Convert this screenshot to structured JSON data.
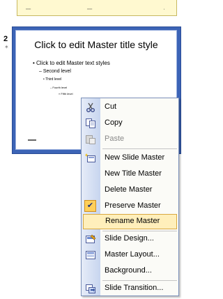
{
  "slides": [
    {
      "number": "",
      "selected": false
    },
    {
      "number": "2",
      "selected": true,
      "title_placeholder": "Click to edit Master title style",
      "body_lines": [
        "Click to edit Master text styles",
        "Second level",
        "Third level",
        "Fourth level",
        "Fifth level"
      ]
    }
  ],
  "context_menu": {
    "items": [
      {
        "label": "Cut",
        "icon": "scissors-icon",
        "enabled": true
      },
      {
        "label": "Copy",
        "icon": "copy-icon",
        "enabled": true
      },
      {
        "label": "Paste",
        "icon": "paste-icon",
        "enabled": false
      },
      {
        "label": "New Slide Master",
        "icon": "new-slide-master-icon",
        "enabled": true
      },
      {
        "label": "New Title Master",
        "icon": "",
        "enabled": true
      },
      {
        "label": "Delete Master",
        "icon": "",
        "enabled": true
      },
      {
        "label": "Preserve Master",
        "icon": "checkmark-icon",
        "enabled": true,
        "checked": true
      },
      {
        "label": "Rename Master",
        "icon": "",
        "enabled": true,
        "highlighted": true
      },
      {
        "label": "Slide Design...",
        "icon": "slide-design-icon",
        "enabled": true
      },
      {
        "label": "Master Layout...",
        "icon": "master-layout-icon",
        "enabled": true
      },
      {
        "label": "Background...",
        "icon": "",
        "enabled": true
      },
      {
        "label": "Slide Transition...",
        "icon": "slide-transition-icon",
        "enabled": true
      }
    ]
  },
  "colors": {
    "selection_frame": "#3c64b6",
    "menu_highlight": "#ffefbb",
    "menu_gutter": "#c7d5ef"
  }
}
